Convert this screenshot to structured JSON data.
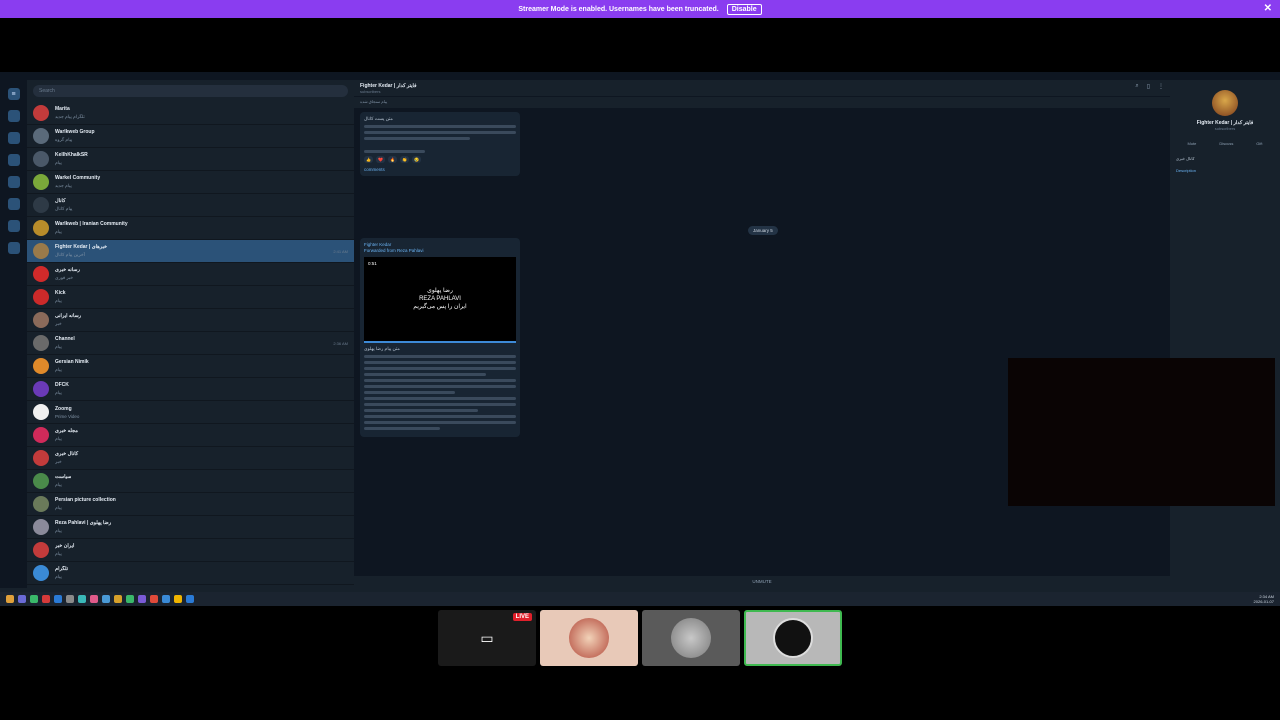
{
  "banner": {
    "message": "Streamer Mode is enabled. Usernames have been truncated.",
    "disable_label": "Disable"
  },
  "chatlist": {
    "search_placeholder": "Search",
    "rows": [
      {
        "name": "Marita",
        "preview": "تلگرام پیام جدید",
        "time": "",
        "badge": "",
        "color": "#c23b3b"
      },
      {
        "name": "Warlkweb Group",
        "preview": "پیام گروه",
        "time": "",
        "badge": "",
        "color": "#5a6a7a"
      },
      {
        "name": "KellhKhalkSR",
        "preview": "پیام",
        "time": "",
        "badge": "",
        "color": "#4a5868"
      },
      {
        "name": "Warkel Community",
        "preview": "پیام جدید",
        "time": "",
        "badge": "",
        "color": "#7aa83a"
      },
      {
        "name": "کانال",
        "preview": "پیام کانال",
        "time": "",
        "badge": "",
        "color": "#2e3a46"
      },
      {
        "name": "Warlkweb | Iranian Community",
        "preview": "پیام",
        "time": "",
        "badge": "",
        "color": "#b88c2a"
      },
      {
        "name": "Fighter Kedar | خبرهای",
        "preview": "آخرین پیام کانال",
        "time": "2:41 AM",
        "badge": "",
        "color": "#9a7a4a"
      },
      {
        "name": "رسانه خبری",
        "preview": "خبر فوری",
        "time": "",
        "badge": "",
        "color": "#d02a2a"
      },
      {
        "name": "Kick",
        "preview": "پیام",
        "time": "",
        "badge": "",
        "color": "#cc2a2a"
      },
      {
        "name": "رسانه ایرانی",
        "preview": "خبر",
        "time": "",
        "badge": "",
        "color": "#8a6a5a"
      },
      {
        "name": "Channel",
        "preview": "پیام",
        "time": "2:36 AM",
        "badge": "",
        "color": "#6a6a6a"
      },
      {
        "name": "Gersian Nimik",
        "preview": "پیام",
        "time": "",
        "badge": "",
        "color": "#e08a2a"
      },
      {
        "name": "DFCK",
        "preview": "پیام",
        "time": "",
        "badge": "",
        "color": "#6a3ab8"
      },
      {
        "name": "Zoomg",
        "preview": "Prime Video",
        "time": "",
        "badge": "",
        "color": "#f0f0f0"
      },
      {
        "name": "مجله خبری",
        "preview": "پیام",
        "time": "",
        "badge": "",
        "color": "#d02a5a"
      },
      {
        "name": "کانال خبری",
        "preview": "خبر",
        "time": "",
        "badge": "",
        "color": "#c23b3b"
      },
      {
        "name": "سیاست",
        "preview": "پیام",
        "time": "",
        "badge": "",
        "color": "#4a8a4a"
      },
      {
        "name": "Persian picture collection",
        "preview": "پیام",
        "time": "",
        "badge": "",
        "color": "#6a7a5a"
      },
      {
        "name": "Reza Pahlavi | رضا پهلوی",
        "preview": "پیام",
        "time": "",
        "badge": "",
        "color": "#8a8a9a"
      },
      {
        "name": "ایران خبر",
        "preview": "پیام",
        "time": "",
        "badge": "",
        "color": "#c23b3b"
      },
      {
        "name": "تلگرام",
        "preview": "پیام",
        "time": "",
        "badge": "",
        "color": "#3a8ad6"
      }
    ]
  },
  "conversation": {
    "title": "Fighter Kedar | فایتر کدار",
    "subtitle": "subscribers",
    "pinned": "پیام سنجاق شده",
    "post1_text": "متن پست کانال",
    "post1_reacts": [
      "👍",
      "❤️",
      "🔥",
      "👏",
      "😢"
    ],
    "comments_label": "comments",
    "date_pill": "January 5",
    "post2_header": "Fighter Kedar",
    "forwarded": "Forwarded from Reza Pahlavi",
    "video_time": "0:51",
    "video_title": "رضا پهلوی\nREZA PAHLAVI\nایران را پس می‌گیریم",
    "post2_text": "متن پیام رضا پهلوی",
    "compose_label": "UNMUTE"
  },
  "profile": {
    "name": "Fighter Kedar | فایتر کدار",
    "subscribers": "subscribers",
    "buttons": [
      "Mute",
      "Discuss",
      "Gift"
    ],
    "description": "کانال خبری",
    "link_label": "Description"
  },
  "taskbar": {
    "time": "2:34 AM",
    "date": "2026-01-07"
  },
  "stream_tiles": {
    "live_label": "LIVE"
  }
}
